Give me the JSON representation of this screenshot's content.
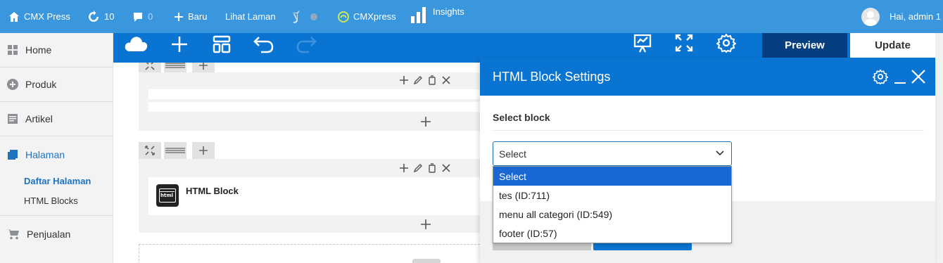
{
  "adminbar": {
    "site_name": "CMX Press",
    "updates_count": "10",
    "comments_count": "0",
    "new_label": "Baru",
    "view_page_label": "Lihat Laman",
    "cmxpress_label": "CMXpress",
    "insights_label": "Insights",
    "greeting": "Hai, admin 1"
  },
  "sidebar": {
    "items": [
      {
        "label": "Home",
        "icon": "dashboard-icon"
      },
      {
        "label": "Produk",
        "icon": "plus-circle-icon"
      },
      {
        "label": "Artikel",
        "icon": "posts-icon"
      },
      {
        "label": "Halaman",
        "icon": "pages-icon"
      },
      {
        "label": "Penjualan",
        "icon": "cart-icon"
      }
    ],
    "subitems": [
      {
        "label": "Daftar Halaman"
      },
      {
        "label": "HTML Blocks"
      }
    ]
  },
  "toolbar": {
    "preview_label": "Preview",
    "update_label": "Update"
  },
  "canvas": {
    "element_label": "HTML Block",
    "element_icon_text": "html"
  },
  "panel": {
    "title": "HTML Block Settings",
    "field_label": "Select block",
    "select_value": "Select",
    "options": [
      {
        "label": "Select"
      },
      {
        "label": "tes (ID:711)"
      },
      {
        "label": "menu all categori (ID:549)"
      },
      {
        "label": "footer (ID:57)"
      }
    ]
  },
  "colors": {
    "adminbar": "#3a96dd",
    "builder_blue": "#0a74d2",
    "preview_dark": "#053f80",
    "option_highlight": "#1967d2"
  }
}
